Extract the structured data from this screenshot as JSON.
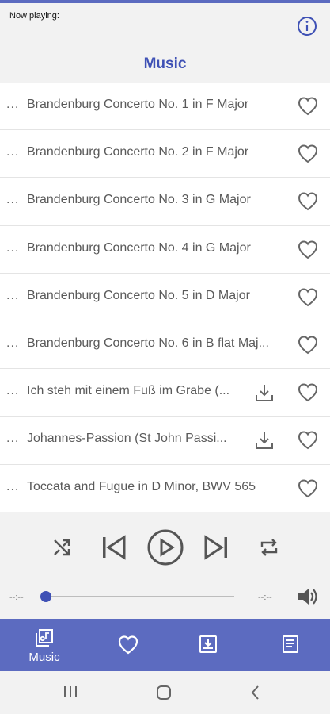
{
  "header": {
    "now_playing_label": "Now playing:",
    "section_title": "Music"
  },
  "tracks": [
    {
      "more": "...",
      "title": "Brandenburg Concerto No. 1 in F Major",
      "downloadable": false
    },
    {
      "more": "...",
      "title": "Brandenburg Concerto No. 2 in F Major",
      "downloadable": false
    },
    {
      "more": "...",
      "title": "Brandenburg Concerto No. 3 in G Major",
      "downloadable": false
    },
    {
      "more": "...",
      "title": "Brandenburg Concerto No. 4 in G Major",
      "downloadable": false
    },
    {
      "more": "...",
      "title": "Brandenburg Concerto No. 5 in D Major",
      "downloadable": false
    },
    {
      "more": "...",
      "title": "Brandenburg Concerto No. 6 in B flat Maj...",
      "downloadable": false
    },
    {
      "more": "...",
      "title": "Ich steh mit einem Fuß im Grabe (...",
      "downloadable": true
    },
    {
      "more": "...",
      "title": "Johannes-Passion (St John Passi...",
      "downloadable": true
    },
    {
      "more": "...",
      "title": "Toccata and Fugue in D Minor, BWV 565",
      "downloadable": false
    }
  ],
  "player": {
    "elapsed": "--:--",
    "duration": "--:--",
    "progress": 0
  },
  "bottom_nav": {
    "items": [
      {
        "label": "Music",
        "icon": "music-library-icon",
        "active": true
      },
      {
        "label": "",
        "icon": "heart-icon",
        "active": false
      },
      {
        "label": "",
        "icon": "download-box-icon",
        "active": false
      },
      {
        "label": "",
        "icon": "notes-icon",
        "active": false
      }
    ]
  },
  "colors": {
    "accent": "#3f51b5",
    "nav_bar": "#5c6bc0",
    "background": "#f2f2f2",
    "icon_gray": "#555555"
  }
}
